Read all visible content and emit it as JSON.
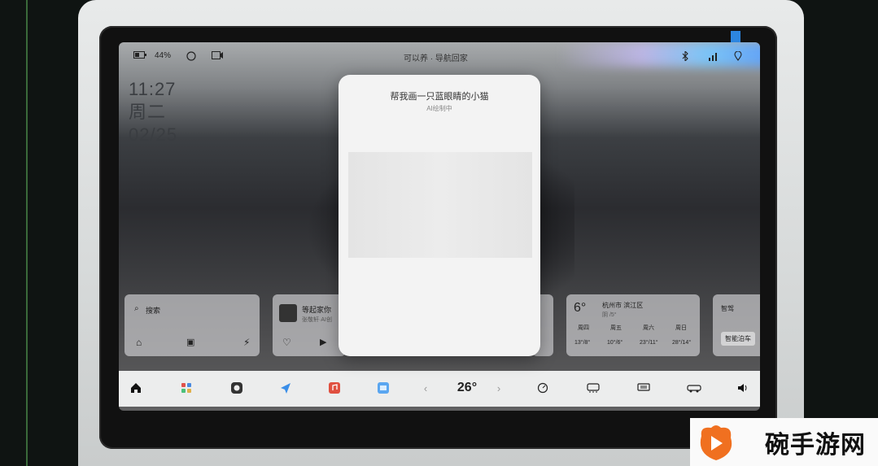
{
  "status": {
    "battery": "44%",
    "center": "可以养 · 导航回家"
  },
  "clock": {
    "time": "11:27",
    "weekday": "周二",
    "date": "02/25"
  },
  "cards": {
    "search": {
      "label": "搜索"
    },
    "media": {
      "title": "等起家你",
      "subtitle": "张敬轩·AI创"
    },
    "weather": {
      "temp": "6°",
      "location": "杭州市 滨江区",
      "condition": "阴 /5°",
      "days": [
        "周四",
        "周五",
        "周六",
        "周日"
      ],
      "ranges": [
        "13°/8°",
        "10°/6°",
        "23°/11°",
        "28°/14°"
      ]
    },
    "misc": {
      "title": "智驾",
      "button": "智能泊车"
    }
  },
  "modal": {
    "title": "帮我画一只蓝眼睛的小猫",
    "status": "AI绘制中"
  },
  "dock": {
    "temperature": "26°"
  },
  "watermark": {
    "text": "碗手游网"
  },
  "colors": {
    "accent_blue": "#2d86e0",
    "logo_orange": "#f07020"
  },
  "icons": [
    "home-icon",
    "apps-icon",
    "camera-icon",
    "nav-icon",
    "music-icon",
    "app-icon",
    "fan-icon",
    "rear-defrost-icon",
    "front-defrost-icon",
    "car-icon",
    "volume-icon"
  ]
}
